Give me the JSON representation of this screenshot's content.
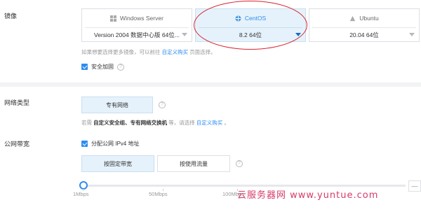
{
  "image_section": {
    "label": "镜像",
    "cards": [
      {
        "name": "Windows Server",
        "version": "Version 2004 数据中心版 64位...",
        "selected": false,
        "icon": "windows-icon"
      },
      {
        "name": "CentOS",
        "version": "8.2 64位",
        "selected": true,
        "icon": "centos-icon"
      },
      {
        "name": "Ubuntu",
        "version": "20.04 64位",
        "selected": false,
        "icon": "ubuntu-icon"
      }
    ],
    "hint_prefix": "如果想要选择更多镜像，可以前往",
    "hint_link": "自定义购买",
    "hint_suffix": "页面选择。",
    "security_label": "安全加固",
    "security_checked": true
  },
  "network_section": {
    "label": "网络类型",
    "option": "专有网络",
    "hint_prefix": "若需",
    "hint_bold": "自定义安全组、专有网络交换机",
    "hint_mid": "等，请选择",
    "hint_link": "自定义购买",
    "hint_suffix": "。"
  },
  "bandwidth_section": {
    "label": "公网带宽",
    "ipv4_label": "分配公网 IPv4 地址",
    "ipv4_checked": true,
    "fixed_label": "按固定带宽",
    "traffic_label": "按使用流量",
    "slider_ticks": [
      "1Mbps",
      "50Mbps",
      "100Mbps"
    ],
    "slider_value_mbps": 1,
    "stepper_label": "—"
  },
  "watermark": "云服务器网 www.yuntue.com",
  "colors": {
    "accent": "#2d8cf0",
    "selected_bg": "#e6f2fb",
    "annotation_red": "#d8252f"
  }
}
